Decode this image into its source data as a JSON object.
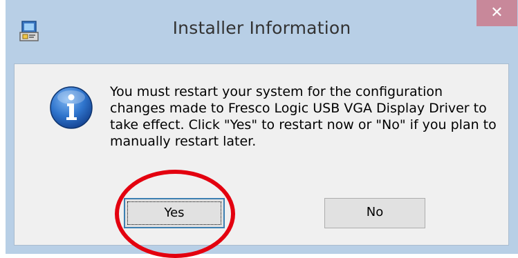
{
  "window": {
    "title": "Installer Information",
    "close_symbol": "✕",
    "app_icon": "installer-icon"
  },
  "dialog": {
    "icon": "info-icon",
    "message": "You must restart your system for the configuration changes made to Fresco Logic USB VGA Display Driver to take effect. Click \"Yes\" to restart now or \"No\" if you plan to manually restart later."
  },
  "buttons": {
    "yes_label": "Yes",
    "no_label": "No"
  },
  "annotation": {
    "type": "red-circle-highlight",
    "target": "yes-button",
    "color": "#e3000f"
  },
  "colors": {
    "titlebar": "#b8cfe6",
    "close_button": "#c8889a",
    "content_bg": "#f0f0f0"
  }
}
